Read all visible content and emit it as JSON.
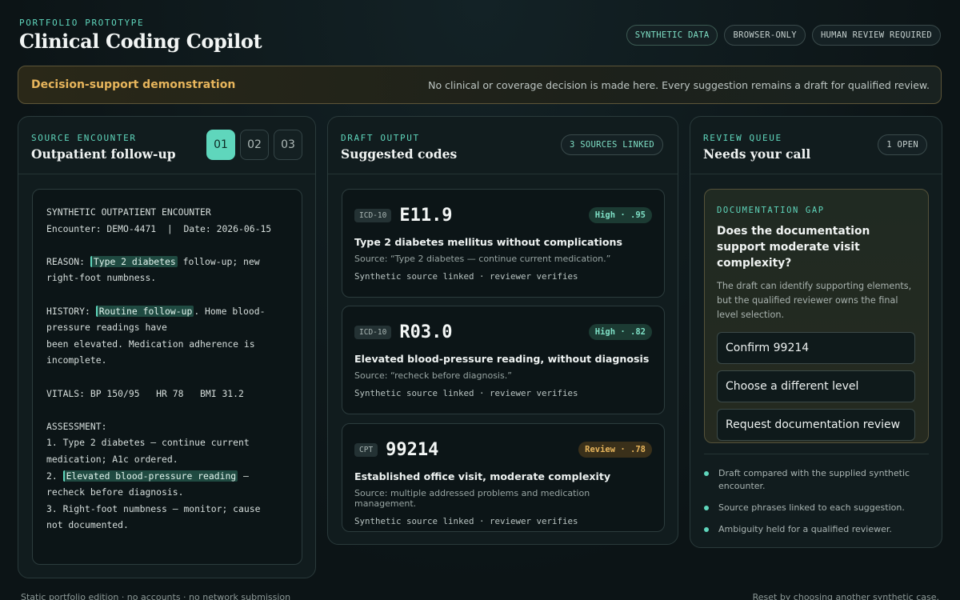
{
  "header": {
    "eyebrow": "PORTFOLIO PROTOTYPE",
    "title": "Clinical Coding Copilot",
    "badges": [
      "SYNTHETIC DATA",
      "BROWSER-ONLY",
      "HUMAN REVIEW REQUIRED"
    ]
  },
  "banner": {
    "title": "Decision-support demonstration",
    "text": "No clinical or coverage decision is made here. Every suggestion remains a draft for qualified review."
  },
  "source": {
    "eyebrow": "SOURCE ENCOUNTER",
    "title": "Outpatient follow-up",
    "tabs": [
      "01",
      "02",
      "03"
    ],
    "active_tab": "01",
    "note": {
      "header1": "SYNTHETIC OUTPATIENT ENCOUNTER",
      "header2": "Encounter: DEMO-4471  |  Date: 2026-06-15",
      "reason_label": "REASON: ",
      "reason_hl": "Type 2 diabetes",
      "reason_rest": " follow-up; new",
      "reason_line2": "right-foot numbness.",
      "history_label": "HISTORY: ",
      "history_hl": "Routine follow-up",
      "history_rest": ". Home blood-",
      "history_line2": "pressure readings have",
      "history_line3": "been elevated. Medication adherence is",
      "history_line4": "incomplete.",
      "vitals": "VITALS: BP 150/95   HR 78   BMI 31.2",
      "assessment_label": "ASSESSMENT:",
      "a1_line1": "1. Type 2 diabetes — continue current",
      "a1_line2": "medication; A1c ordered.",
      "a2_prefix": "2. ",
      "a2_hl": "Elevated blood-pressure reading",
      "a2_rest": " —",
      "a2_line2": "recheck before diagnosis.",
      "a3_line1": "3. Right-foot numbness — monitor; cause",
      "a3_line2": "not documented."
    }
  },
  "draft": {
    "eyebrow": "DRAFT OUTPUT",
    "title": "Suggested codes",
    "pill": "3 SOURCES LINKED",
    "codes": [
      {
        "system": "ICD-10",
        "code": "E11.9",
        "confidence": "High · .95",
        "level": "high",
        "description": "Type 2 diabetes mellitus without complications",
        "source": "Source: “Type 2 diabetes — continue current medication.”",
        "link": "Synthetic source linked · reviewer verifies"
      },
      {
        "system": "ICD-10",
        "code": "R03.0",
        "confidence": "High · .82",
        "level": "high",
        "description": "Elevated blood-pressure reading, without diagnosis",
        "source": "Source: “recheck before diagnosis.”",
        "link": "Synthetic source linked · reviewer verifies"
      },
      {
        "system": "CPT",
        "code": "99214",
        "confidence": "Review · .78",
        "level": "review",
        "description": "Established office visit, moderate complexity",
        "source": "Source: multiple addressed problems and medication management.",
        "link": "Synthetic source linked · reviewer verifies"
      }
    ]
  },
  "review": {
    "eyebrow": "REVIEW QUEUE",
    "title": "Needs your call",
    "pill": "1 OPEN",
    "card": {
      "eyebrow": "DOCUMENTATION GAP",
      "question": "Does the documentation support moderate visit complexity?",
      "explanation": "The draft can identify supporting elements, but the qualified reviewer owns the final level selection.",
      "options": [
        "Confirm 99214",
        "Choose a different level",
        "Request documentation review"
      ]
    },
    "checklist": [
      "Draft compared with the supplied synthetic encounter.",
      "Source phrases linked to each suggestion.",
      "Ambiguity held for a qualified reviewer."
    ]
  },
  "footer": {
    "left": "Static portfolio edition · no accounts · no network submission",
    "right": "Reset by choosing another synthetic case."
  },
  "colors": {
    "accent": "#5fd6bc",
    "warning": "#e8b65c",
    "background": "#0d1618"
  }
}
